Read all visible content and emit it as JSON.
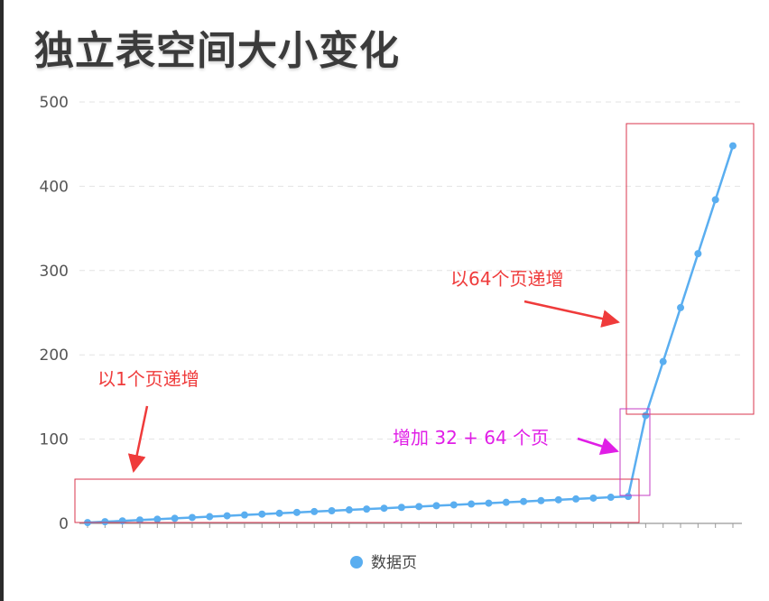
{
  "chart_data": {
    "type": "line",
    "title": "独立表空间大小变化",
    "ylim": [
      0,
      500
    ],
    "yticks": [
      0,
      100,
      200,
      300,
      400,
      500
    ],
    "grid": true,
    "legend_position": "bottom",
    "series": [
      {
        "name": "数据页",
        "color": "#5aaef0",
        "values": [
          1,
          2,
          3,
          4,
          5,
          6,
          7,
          8,
          9,
          10,
          11,
          12,
          13,
          14,
          15,
          16,
          17,
          18,
          19,
          20,
          21,
          22,
          23,
          24,
          25,
          26,
          27,
          28,
          29,
          30,
          31,
          32,
          128,
          192,
          256,
          320,
          384,
          448
        ]
      }
    ],
    "annotations": {
      "label_64": "以64个页递增",
      "label_1": "以1个页递增",
      "label_jump": "增加 32 + 64 个页"
    }
  },
  "colors": {
    "annotation_red": "#ef3b3b",
    "annotation_magenta": "#e01ee6",
    "box_red": "#d9344e",
    "box_magenta": "#c43cc4"
  }
}
